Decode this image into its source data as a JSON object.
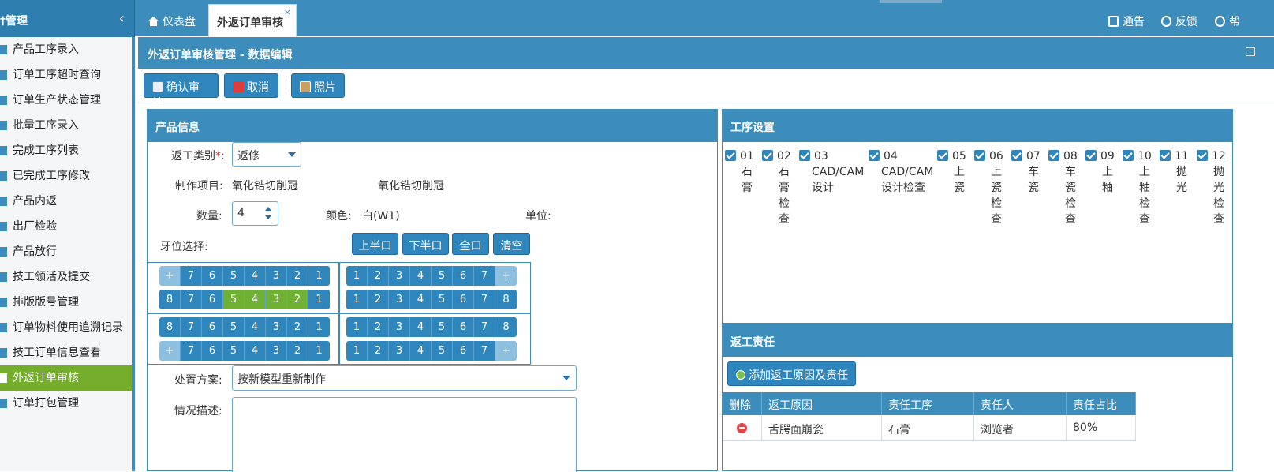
{
  "sidebar": {
    "title": "†管理",
    "items": [
      {
        "label": "产品工序录入"
      },
      {
        "label": "订单工序超时查询"
      },
      {
        "label": "订单生产状态管理"
      },
      {
        "label": "批量工序录入"
      },
      {
        "label": "完成工序列表"
      },
      {
        "label": "已完成工序修改"
      },
      {
        "label": "产品内返"
      },
      {
        "label": "出厂检验"
      },
      {
        "label": "产品放行"
      },
      {
        "label": "技工领活及提交"
      },
      {
        "label": "排版版号管理"
      },
      {
        "label": "订单物料使用追溯记录"
      },
      {
        "label": "技工订单信息查看"
      },
      {
        "label": "外返订单审核"
      },
      {
        "label": "订单打包管理"
      }
    ]
  },
  "tabs": {
    "dashboard": "仪表盘",
    "active": "外返订单审核",
    "close": "×"
  },
  "top_links": {
    "notice": "通告",
    "feedback": "反馈",
    "help": "帮"
  },
  "page_title": "外返订单审核管理 - 数据编辑",
  "toolbar": {
    "confirm": "确认审核",
    "cancel": "取消",
    "photo": "照片"
  },
  "info": {
    "title": "产品信息",
    "rework_type_label": "返工类别",
    "rework_type_value": "返修",
    "item_label": "制作项目:",
    "item_value1": "氧化锆切削冠",
    "item_value2": "氧化锆切削冠",
    "qty_label": "数量:",
    "qty_value": "4",
    "color_label": "颜色:",
    "color_value": "白(W1)",
    "unit_label": "单位:",
    "tooth_label": "牙位选择:",
    "btn_upper": "上半口",
    "btn_lower": "下半口",
    "btn_full": "全口",
    "btn_clear": "清空",
    "plan_label": "处置方案:",
    "plan_value": "按新模型重新制作",
    "desc_label": "情况描述:"
  },
  "teeth": {
    "ul_row1": [
      "+",
      "7",
      "6",
      "5",
      "4",
      "3",
      "2",
      "1"
    ],
    "ul_row2": [
      "8",
      "7",
      "6",
      "5",
      "4",
      "3",
      "2",
      "1"
    ],
    "ur_row1": [
      "1",
      "2",
      "3",
      "4",
      "5",
      "6",
      "7",
      "+"
    ],
    "ur_row2": [
      "1",
      "2",
      "3",
      "4",
      "5",
      "6",
      "7",
      "8"
    ],
    "ll_row1": [
      "8",
      "7",
      "6",
      "5",
      "4",
      "3",
      "2",
      "1"
    ],
    "ll_row2": [
      "+",
      "7",
      "6",
      "5",
      "4",
      "3",
      "2",
      "1"
    ],
    "lr_row1": [
      "1",
      "2",
      "3",
      "4",
      "5",
      "6",
      "7",
      "8"
    ],
    "lr_row2": [
      "1",
      "2",
      "3",
      "4",
      "5",
      "6",
      "7",
      "+"
    ],
    "selected_ul_row2": [
      "5",
      "4",
      "3",
      "2"
    ]
  },
  "process": {
    "title": "工序设置",
    "items": [
      {
        "num": "01",
        "name": "石膏",
        "checked": true
      },
      {
        "num": "02",
        "name": "石膏检查",
        "checked": true
      },
      {
        "num": "03",
        "name": "CAD/CAM设计",
        "checked": true
      },
      {
        "num": "04",
        "name": "CAD/CAM设计检查",
        "checked": true
      },
      {
        "num": "05",
        "name": "上瓷",
        "checked": true
      },
      {
        "num": "06",
        "name": "上瓷检查",
        "checked": true
      },
      {
        "num": "07",
        "name": "车瓷",
        "checked": true
      },
      {
        "num": "08",
        "name": "车瓷检查",
        "checked": true
      },
      {
        "num": "09",
        "name": "上釉",
        "checked": true
      },
      {
        "num": "10",
        "name": "上釉检查",
        "checked": true
      },
      {
        "num": "11",
        "name": "抛光",
        "checked": true
      },
      {
        "num": "12",
        "name": "抛光检查",
        "checked": true
      }
    ]
  },
  "responsibility": {
    "title": "返工责任",
    "add_button": "添加返工原因及责任",
    "columns": [
      "删除",
      "返工原因",
      "责任工序",
      "责任人",
      "责任占比"
    ],
    "rows": [
      {
        "reason": "舌腭面崩瓷",
        "process": "石膏",
        "person": "浏览者",
        "ratio": "80%"
      }
    ]
  },
  "colors": {
    "primary": "#3c8dbc",
    "active_nav": "#74ad2c",
    "selected_tooth": "#6fb133"
  }
}
